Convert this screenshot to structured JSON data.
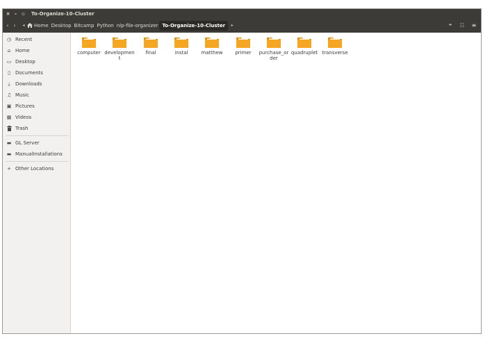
{
  "window": {
    "title": "To-Organize-10-Cluster",
    "controls": {
      "close": "×",
      "minimize": "–",
      "maximize": "▫"
    }
  },
  "toolbar": {
    "back_glyph": "‹",
    "forward_glyph": "›",
    "crumb_prev_glyph": "◂",
    "crumb_next_glyph": "▸",
    "breadcrumbs": [
      "Home",
      "Desktop",
      "Bitcamp",
      "Python",
      "nlp-file-organizer",
      "To-Organize-10-Cluster"
    ],
    "search_glyph": "⌖",
    "view_glyph": "☷",
    "menu_glyph": "≡"
  },
  "sidebar": {
    "places": [
      {
        "label": "Recent",
        "icon": "clock-icon",
        "glyph": "◷"
      },
      {
        "label": "Home",
        "icon": "home-icon",
        "glyph": "⌂"
      },
      {
        "label": "Desktop",
        "icon": "desktop-icon",
        "glyph": "▭"
      },
      {
        "label": "Documents",
        "icon": "document-icon",
        "glyph": "▯"
      },
      {
        "label": "Downloads",
        "icon": "download-icon",
        "glyph": "⤓"
      },
      {
        "label": "Music",
        "icon": "music-icon",
        "glyph": "♫"
      },
      {
        "label": "Pictures",
        "icon": "picture-icon",
        "glyph": "▣"
      },
      {
        "label": "Videos",
        "icon": "video-icon",
        "glyph": "▦"
      },
      {
        "label": "Trash",
        "icon": "trash-icon",
        "glyph": "🗑"
      }
    ],
    "devices": [
      {
        "label": "GL Server",
        "icon": "drive-icon",
        "glyph": "▬"
      },
      {
        "label": "ManualInstallations",
        "icon": "drive-icon",
        "glyph": "▬"
      }
    ],
    "other": {
      "label": "Other Locations",
      "icon": "plus-icon",
      "glyph": "+"
    }
  },
  "folders": [
    "computer",
    "development",
    "final",
    "instal",
    "matthew",
    "primer",
    "purchase_order",
    "quadruplet",
    "transverse"
  ],
  "colors": {
    "titlebar": "#3c3b37",
    "folder": "#f5a623",
    "folder_tab": "#e08e0b",
    "sidebar": "#f2f1f0"
  }
}
